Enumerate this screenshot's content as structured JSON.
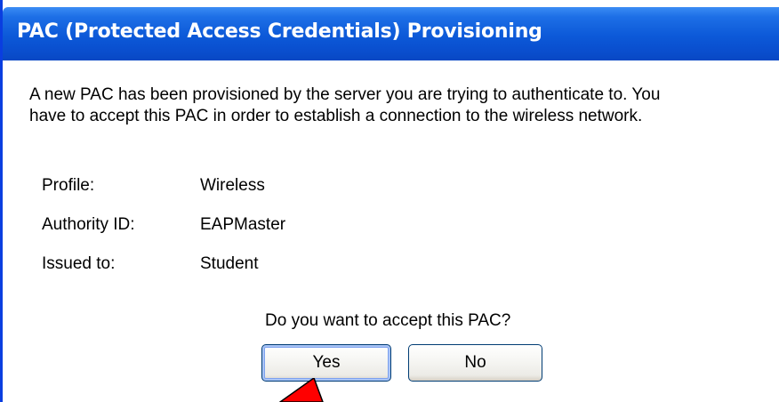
{
  "dialog": {
    "title": "PAC (Protected Access Credentials) Provisioning",
    "message_line1": "A new PAC has been provisioned by the server you are trying to authenticate to. You",
    "message_line2": "have to accept this PAC in order to establish a connection to the wireless network."
  },
  "fields": [
    {
      "label": "Profile:",
      "value": "Wireless"
    },
    {
      "label": "Authority ID:",
      "value": "EAPMaster"
    },
    {
      "label": "Issued to:",
      "value": "Student"
    }
  ],
  "prompt": "Do you want to accept this PAC?",
  "buttons": {
    "yes_label": "Yes",
    "no_label": "No"
  },
  "colors": {
    "titlebar": "#0a4fcf",
    "annotation_arrow": "#ff0000"
  },
  "icons": [
    "pointer-arrow-icon"
  ]
}
